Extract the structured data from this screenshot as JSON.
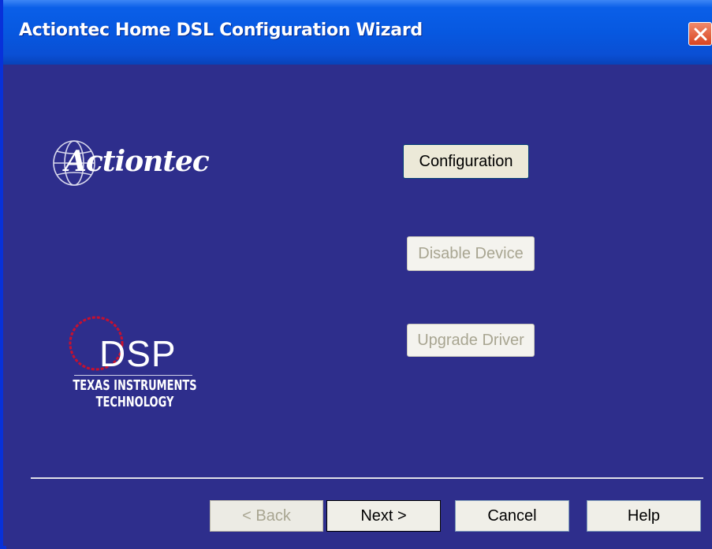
{
  "window": {
    "title": "Actiontec Home DSL Configuration Wizard"
  },
  "logos": {
    "actiontec": "Actiontec",
    "dsp": {
      "mark": "DSP",
      "line1": "TEXAS INSTRUMENTS",
      "line2": "TECHNOLOGY"
    }
  },
  "actions": {
    "configuration": "Configuration",
    "disable_device": "Disable Device",
    "upgrade_driver": "Upgrade Driver"
  },
  "footer": {
    "back": "< Back",
    "next": "Next >",
    "cancel": "Cancel",
    "help": "Help"
  },
  "icons": {
    "close": "close-icon",
    "globe": "globe-icon"
  },
  "colors": {
    "background": "#2e2e8c",
    "titlebar": "#0758e0",
    "close": "#d94420",
    "dsp_circle": "#c8102e"
  }
}
